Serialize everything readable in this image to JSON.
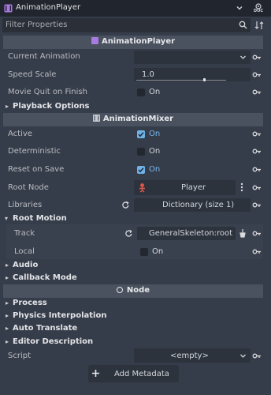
{
  "header": {
    "title": "AnimationPlayer",
    "doc_label": "DOC",
    "filter_placeholder": "Filter Properties"
  },
  "sections": {
    "animation_player": "AnimationPlayer",
    "animation_mixer": "AnimationMixer",
    "node": "Node"
  },
  "props": {
    "current_animation": "Current Animation",
    "speed_scale": "Speed Scale",
    "speed_scale_value": "1.0",
    "movie_quit": "Movie Quit on Finish",
    "movie_quit_value": "On",
    "playback_options": "Playback Options",
    "active": "Active",
    "active_value": "On",
    "deterministic": "Deterministic",
    "deterministic_value": "On",
    "reset_on_save": "Reset on Save",
    "reset_on_save_value": "On",
    "root_node": "Root Node",
    "root_node_value": "Player",
    "libraries": "Libraries",
    "libraries_value": "Dictionary (size 1)",
    "root_motion": "Root Motion",
    "track": "Track",
    "track_value": "GeneralSkeleton:root",
    "local": "Local",
    "local_value": "On",
    "audio": "Audio",
    "callback_mode": "Callback Mode",
    "process": "Process",
    "physics_interpolation": "Physics Interpolation",
    "auto_translate": "Auto Translate",
    "editor_description": "Editor Description",
    "script": "Script",
    "script_value": "<empty>",
    "add_metadata": "Add Metadata"
  },
  "state": {
    "speed_scale_fraction": 0.65,
    "movie_quit_checked": false,
    "active_checked": true,
    "deterministic_checked": false,
    "reset_on_save_checked": true,
    "local_checked": false
  },
  "colors": {
    "accent": "#6fb2e8",
    "panel_bg": "#363d4a",
    "section_bg": "#4a525f",
    "node_icon": "#e05a4c"
  },
  "icons": {
    "header": "animation-player-icon",
    "doc": "doc-icon",
    "search": "search-icon",
    "filter_options": "filter-options-icon",
    "mixer": "animation-mixer-icon",
    "node": "node-circle-icon",
    "root_node": "skeleton-node-icon",
    "revert": "key-icon",
    "reload": "reload-icon"
  }
}
